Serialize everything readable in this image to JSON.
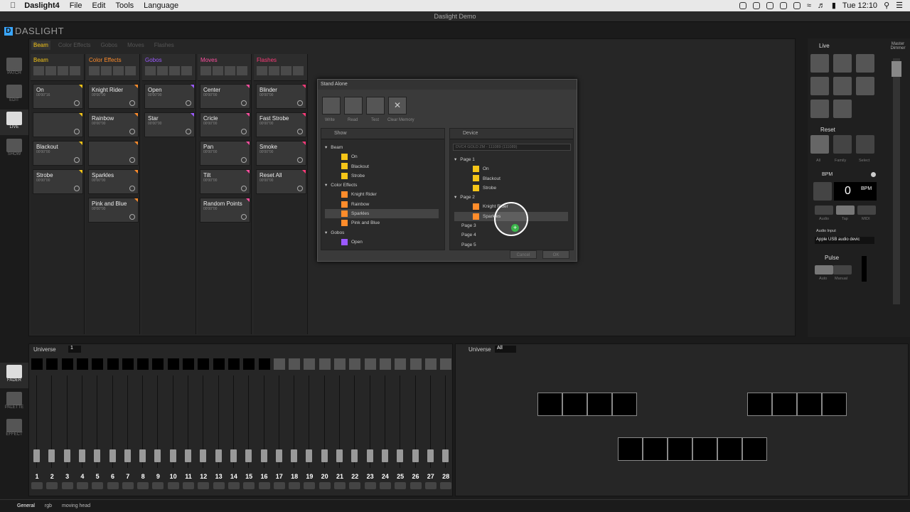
{
  "menubar": {
    "app": "Daslight4",
    "items": [
      "File",
      "Edit",
      "Tools",
      "Language"
    ],
    "clock": "Tue 12:10"
  },
  "window_title": "Daslight Demo",
  "logo": "DASLIGHT",
  "nav": [
    "PATCH",
    "EDIT",
    "LIVE",
    "SHOW"
  ],
  "tabs": [
    "Beam",
    "Color Effects",
    "Gobos",
    "Moves",
    "Flashes"
  ],
  "columns": [
    {
      "title": "Beam",
      "color": "#f5c518",
      "scenes": [
        {
          "n": "On",
          "t": "00'00\"16"
        },
        {
          "n": "",
          "t": ""
        },
        {
          "n": "Blackout",
          "t": "00'00\"00"
        },
        {
          "n": "Strobe",
          "t": "00'00\"00"
        }
      ]
    },
    {
      "title": "Color Effects",
      "color": "#ff8c2b",
      "scenes": [
        {
          "n": "Knight Rider",
          "t": "00'00\"00"
        },
        {
          "n": "Rainbow",
          "t": "00'00\"00"
        },
        {
          "n": "",
          "t": ""
        },
        {
          "n": "Sparkles",
          "t": "00'00\"00"
        },
        {
          "n": "Pink and Blue",
          "t": "00'00\"00"
        }
      ]
    },
    {
      "title": "Gobos",
      "color": "#9b59ff",
      "scenes": [
        {
          "n": "Open",
          "t": "00'00\"00"
        },
        {
          "n": "Star",
          "t": "00'00\"00"
        }
      ]
    },
    {
      "title": "Moves",
      "color": "#ff4fa0",
      "scenes": [
        {
          "n": "Center",
          "t": "00'00\"00"
        },
        {
          "n": "Cricle",
          "t": "00'00\"00"
        },
        {
          "n": "Pan",
          "t": "00'00\"00"
        },
        {
          "n": "Tilt",
          "t": "00'00\"00"
        },
        {
          "n": "Random Points",
          "t": "00'00\"00"
        }
      ]
    },
    {
      "title": "Flashes",
      "color": "#ff3b7a",
      "scenes": [
        {
          "n": "Blinder",
          "t": "00'00\"00"
        },
        {
          "n": "Fast Strobe",
          "t": "00'00\"00"
        },
        {
          "n": "Smoke",
          "t": "00'00\"00"
        },
        {
          "n": "Reset All",
          "t": "00'00\"00"
        }
      ]
    }
  ],
  "dialog": {
    "title": "Stand Alone",
    "toolbar": [
      "Write",
      "Read",
      "Test",
      "Clear Memory"
    ],
    "show_label": "Show",
    "device_label": "Device",
    "device_select": "DVC4 GOLD ZM - 111089 (111089)",
    "show_tree": [
      {
        "type": "group",
        "label": "Beam"
      },
      {
        "type": "item",
        "label": "On",
        "color": "#f5c518"
      },
      {
        "type": "item",
        "label": "Blackout",
        "color": "#f5c518"
      },
      {
        "type": "item",
        "label": "Strobe",
        "color": "#f5c518"
      },
      {
        "type": "group",
        "label": "Color Effects"
      },
      {
        "type": "item",
        "label": "Knight Rider",
        "color": "#ff8c2b"
      },
      {
        "type": "item",
        "label": "Rainbow",
        "color": "#ff8c2b"
      },
      {
        "type": "item",
        "label": "Sparkles",
        "color": "#ff8c2b",
        "selected": true
      },
      {
        "type": "item",
        "label": "Pink and Blue",
        "color": "#ff8c2b"
      },
      {
        "type": "group",
        "label": "Gobos"
      },
      {
        "type": "item",
        "label": "Open",
        "color": "#9b59ff"
      }
    ],
    "device_tree": [
      {
        "type": "group",
        "label": "Page 1"
      },
      {
        "type": "item",
        "label": "On",
        "color": "#f5c518"
      },
      {
        "type": "item",
        "label": "Blackout",
        "color": "#f5c518"
      },
      {
        "type": "item",
        "label": "Strobe",
        "color": "#f5c518"
      },
      {
        "type": "group",
        "label": "Page 2"
      },
      {
        "type": "item",
        "label": "Knight Rider",
        "color": "#ff8c2b"
      },
      {
        "type": "item",
        "label": "Sparkles",
        "color": "#ff8c2b",
        "selected": true
      },
      {
        "type": "plain",
        "label": "Page 3"
      },
      {
        "type": "plain",
        "label": "Page 4"
      },
      {
        "type": "plain",
        "label": "Page 5"
      }
    ],
    "cancel": "Cancel",
    "ok": "OK"
  },
  "right": {
    "live": "Live",
    "master": "Master Dimmer",
    "reset": "Reset",
    "all": "All",
    "family": "Family",
    "select": "Select",
    "bpm_label": "BPM",
    "bpm": "0",
    "bpm_unit": "BPM",
    "audio": "Audio",
    "tap": "Tap",
    "midi": "MIDI",
    "audio_input": "Audio Input",
    "audio_device": "Apple USB audio devic",
    "pulse": "Pulse",
    "auto": "Auto",
    "manual": "Manual"
  },
  "universe_left": {
    "label": "Universe",
    "value": "1"
  },
  "universe_right": {
    "label": "Universe",
    "value": "All"
  },
  "fader_nav": [
    "FADER",
    "PALETTE",
    "EFFECT"
  ],
  "channels": [
    "1",
    "2",
    "3",
    "4",
    "5",
    "6",
    "7",
    "8",
    "9",
    "10",
    "11",
    "12",
    "13",
    "14",
    "15",
    "16",
    "17",
    "18",
    "19",
    "20",
    "21",
    "22",
    "23",
    "24",
    "25",
    "26",
    "27",
    "28"
  ],
  "off": "off",
  "status": [
    "General",
    "rgb",
    "moving head"
  ]
}
